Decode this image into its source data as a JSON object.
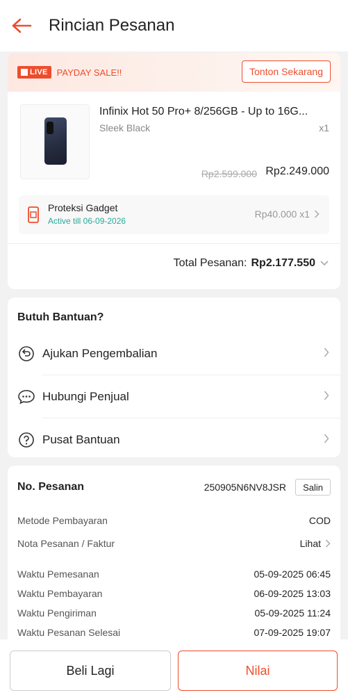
{
  "header": {
    "title": "Rincian Pesanan",
    "back_icon": "arrow-left-icon"
  },
  "colors": {
    "accent": "#ee4d2d",
    "success": "#26aa99",
    "muted": "#888888"
  },
  "banner": {
    "live_badge": "LIVE",
    "label": "PAYDAY SALE!!",
    "watch_button": "Tonton Sekarang"
  },
  "product": {
    "name": "Infinix Hot 50 Pro+ 8/256GB - Up to 16G...",
    "variant": "Sleek Black",
    "quantity": "x1",
    "original_price": "Rp2.599.000",
    "price": "Rp2.249.000"
  },
  "protection": {
    "title": "Proteksi Gadget",
    "status": "Active till 06-09-2026",
    "price": "Rp40.000 x1"
  },
  "total": {
    "label": "Total Pesanan:",
    "value": "Rp2.177.550"
  },
  "help": {
    "title": "Butuh Bantuan?",
    "items": [
      {
        "label": "Ajukan Pengembalian",
        "icon": "return-icon"
      },
      {
        "label": "Hubungi Penjual",
        "icon": "chat-icon"
      },
      {
        "label": "Pusat Bantuan",
        "icon": "question-icon"
      }
    ]
  },
  "order": {
    "label": "No. Pesanan",
    "number": "250905N6NV8JSR",
    "copy_button": "Salin",
    "payment_method_label": "Metode Pembayaran",
    "payment_method_value": "COD",
    "invoice_label": "Nota Pesanan / Faktur",
    "invoice_value": "Lihat",
    "times": [
      {
        "label": "Waktu Pemesanan",
        "value": "05-09-2025 06:45"
      },
      {
        "label": "Waktu Pembayaran",
        "value": "06-09-2025 13:03"
      },
      {
        "label": "Waktu Pengiriman",
        "value": "05-09-2025 11:24"
      },
      {
        "label": "Waktu Pesanan Selesai",
        "value": "07-09-2025 19:07"
      }
    ]
  },
  "actions": {
    "buy_again": "Beli Lagi",
    "rate": "Nilai"
  }
}
